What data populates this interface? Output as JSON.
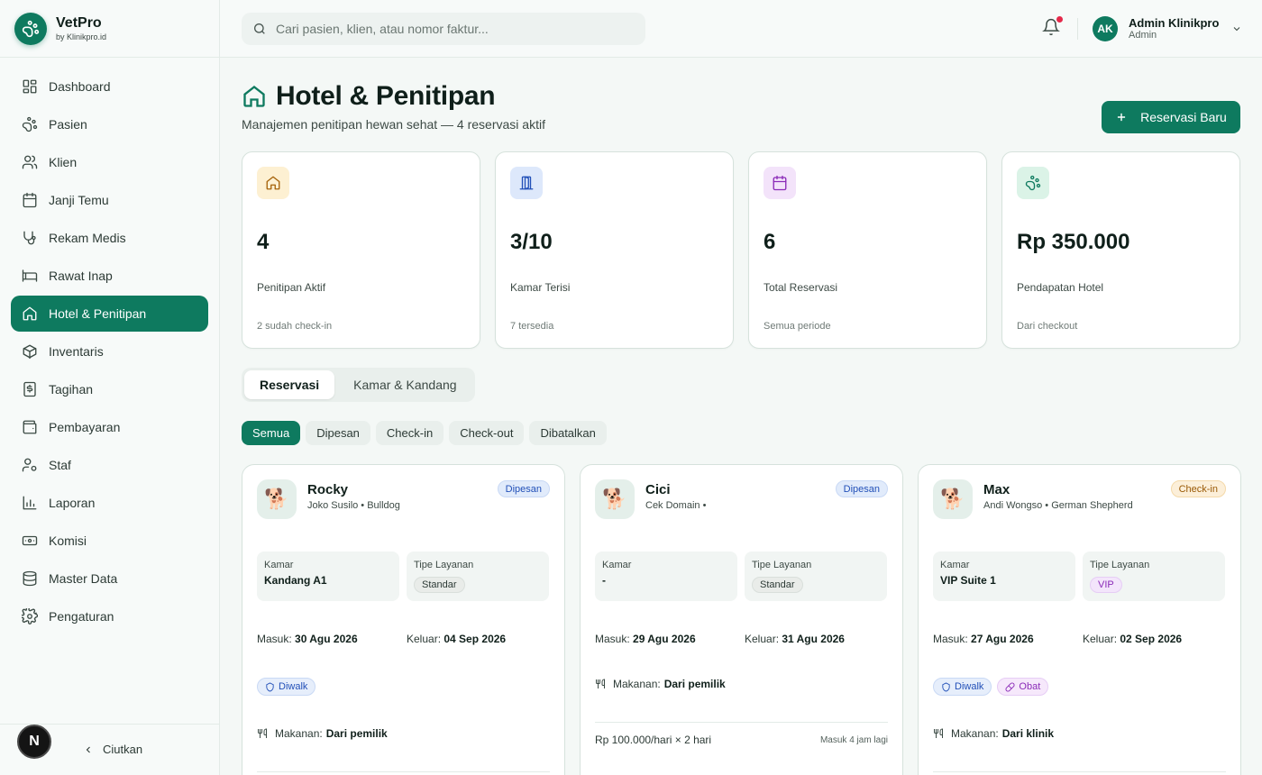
{
  "brand": {
    "name": "VetPro",
    "sub": "by Klinikpro.id"
  },
  "nav": [
    {
      "label": "Dashboard",
      "icon": "grid-icon"
    },
    {
      "label": "Pasien",
      "icon": "paw-icon"
    },
    {
      "label": "Klien",
      "icon": "users-icon"
    },
    {
      "label": "Janji Temu",
      "icon": "calendar-icon"
    },
    {
      "label": "Rekam Medis",
      "icon": "stethoscope-icon"
    },
    {
      "label": "Rawat Inap",
      "icon": "bed-icon"
    },
    {
      "label": "Hotel & Penitipan",
      "icon": "home-icon",
      "active": true
    },
    {
      "label": "Inventaris",
      "icon": "package-icon"
    },
    {
      "label": "Tagihan",
      "icon": "receipt-icon"
    },
    {
      "label": "Pembayaran",
      "icon": "wallet-icon"
    },
    {
      "label": "Staf",
      "icon": "user-cog-icon"
    },
    {
      "label": "Laporan",
      "icon": "bar-chart-icon"
    },
    {
      "label": "Komisi",
      "icon": "banknote-icon"
    },
    {
      "label": "Master Data",
      "icon": "database-icon"
    },
    {
      "label": "Pengaturan",
      "icon": "settings-icon"
    }
  ],
  "sidebar_footer": {
    "badge": "N",
    "collapse_label": "Ciutkan"
  },
  "search": {
    "placeholder": "Cari pasien, klien, atau nomor faktur..."
  },
  "user": {
    "initials": "AK",
    "name": "Admin Klinikpro",
    "role": "Admin"
  },
  "page": {
    "title": "Hotel & Penitipan",
    "subtitle": "Manajemen penitipan hewan sehat — 4 reservasi aktif",
    "new_button": "Reservasi Baru"
  },
  "stats": [
    {
      "value": "4",
      "label": "Penitipan Aktif",
      "foot": "2 sudah check-in",
      "icon": "home-icon",
      "bg": "#fdf0d2",
      "fg": "#a5620a"
    },
    {
      "value": "3/10",
      "label": "Kamar Terisi",
      "foot": "7 tersedia",
      "icon": "door-icon",
      "bg": "#dde8fb",
      "fg": "#2250b8"
    },
    {
      "value": "6",
      "label": "Total Reservasi",
      "foot": "Semua periode",
      "icon": "calendar-icon",
      "bg": "#f3e3fa",
      "fg": "#8b2bb8"
    },
    {
      "value": "Rp 350.000",
      "label": "Pendapatan Hotel",
      "foot": "Dari checkout",
      "icon": "paw-icon",
      "bg": "#dbf3e7",
      "fg": "#0e7a5f"
    }
  ],
  "tabs": [
    "Reservasi",
    "Kamar & Kandang"
  ],
  "filters": [
    "Semua",
    "Dipesan",
    "Check-in",
    "Check-out",
    "Dibatalkan"
  ],
  "labels": {
    "room": "Kamar",
    "service": "Tipe Layanan",
    "in": "Masuk:",
    "out": "Keluar:",
    "food": "Makanan:"
  },
  "reservations": [
    {
      "name": "Rocky",
      "sub": "Joko Susilo • Bulldog",
      "status": "Dipesan",
      "room": "Kandang A1",
      "service": "Standar",
      "in": "30 Agu 2026",
      "out": "04 Sep 2026",
      "tags": [
        "Diwalk"
      ],
      "food": "Dari pemilik"
    },
    {
      "name": "Cici",
      "sub": "Cek Domain •",
      "status": "Dipesan",
      "room": "-",
      "service": "Standar",
      "in": "29 Agu 2026",
      "out": "31 Agu 2026",
      "tags": [],
      "food": "Dari pemilik",
      "price": "Rp 100.000/hari × 2 hari",
      "eta": "Masuk 4 jam lagi"
    },
    {
      "name": "Max",
      "sub": "Andi Wongso • German Shepherd",
      "status": "Check-in",
      "room": "VIP Suite 1",
      "service": "VIP",
      "in": "27 Agu 2026",
      "out": "02 Sep 2026",
      "tags": [
        "Diwalk",
        "Obat"
      ],
      "food": "Dari klinik"
    }
  ]
}
